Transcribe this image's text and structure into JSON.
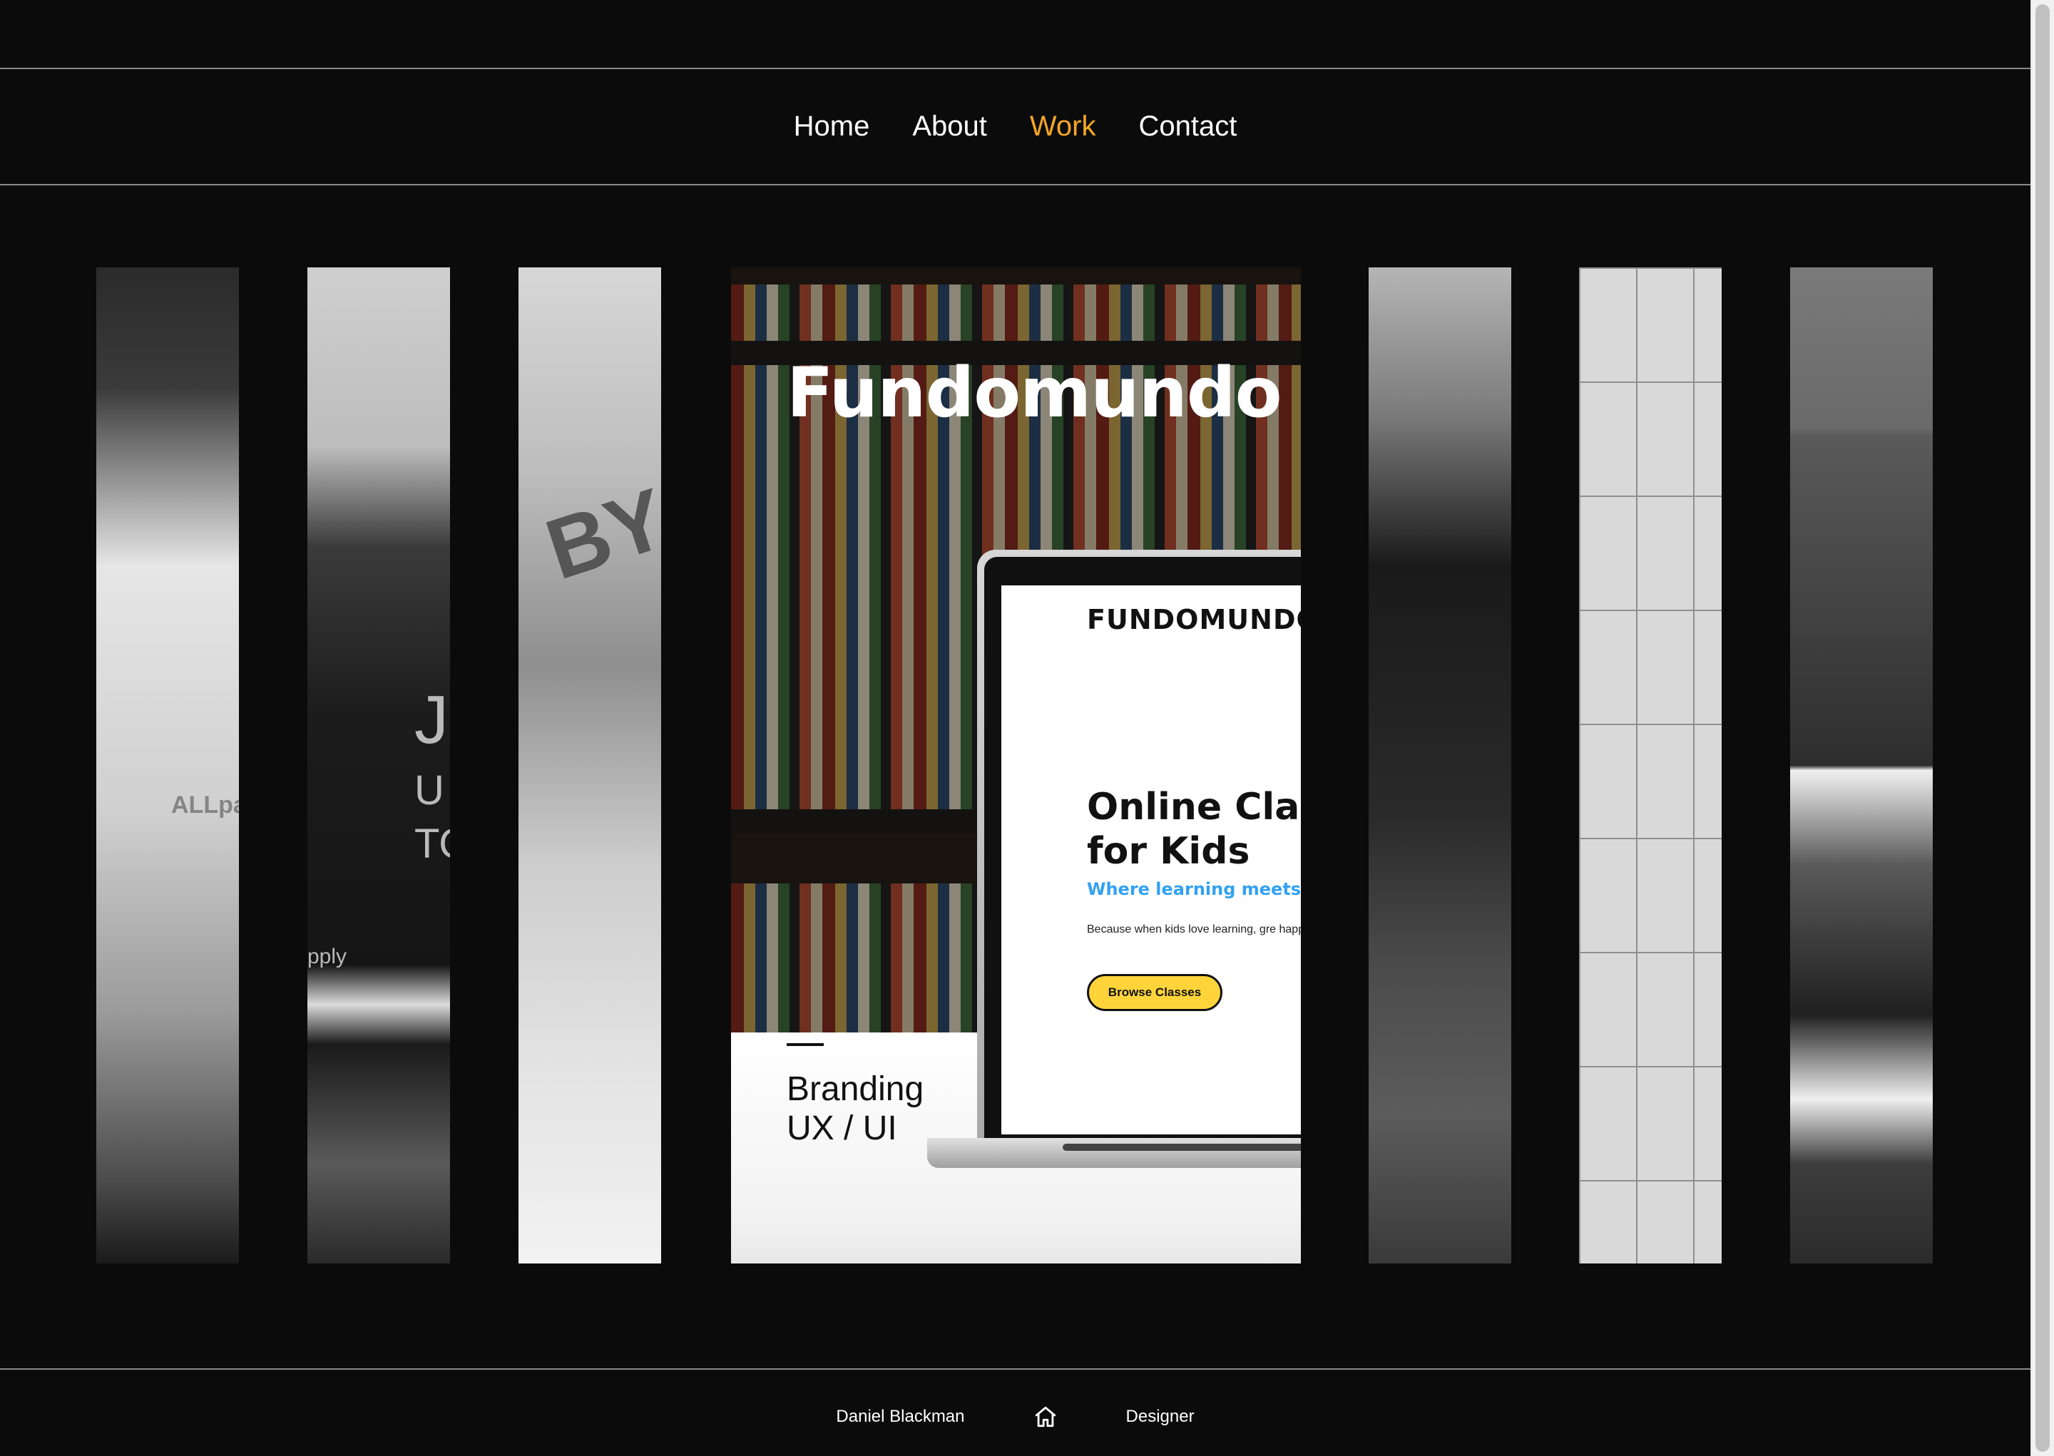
{
  "nav": {
    "items": [
      {
        "label": "Home",
        "active": false
      },
      {
        "label": "About",
        "active": false
      },
      {
        "label": "Work",
        "active": true
      },
      {
        "label": "Contact",
        "active": false
      }
    ]
  },
  "featured": {
    "title": "Fundomundo",
    "tags_line1": "Branding",
    "tags_line2": "UX / UI",
    "laptop_screen": {
      "logo": "FUNDOMUNDO",
      "headline_line1": "Online Clas",
      "headline_line2": "for Kids",
      "subhead": "Where learning meets",
      "body": "Because when kids love learning, gre happen.",
      "button_label": "Browse Classes"
    }
  },
  "strips": {
    "strip2_text_1": "J",
    "strip2_text_2": "U",
    "strip2_text_3": "TO",
    "strip2_text_4": "pply",
    "strip3_text": "BY",
    "strip1_text": "ALLpa"
  },
  "footer": {
    "left": "Daniel Blackman",
    "icon": "home-icon",
    "right": "Designer"
  },
  "colors": {
    "background": "#0b0b0b",
    "accent": "#f5a623",
    "text": "#ffffff",
    "divider": "#8a8a8a"
  }
}
